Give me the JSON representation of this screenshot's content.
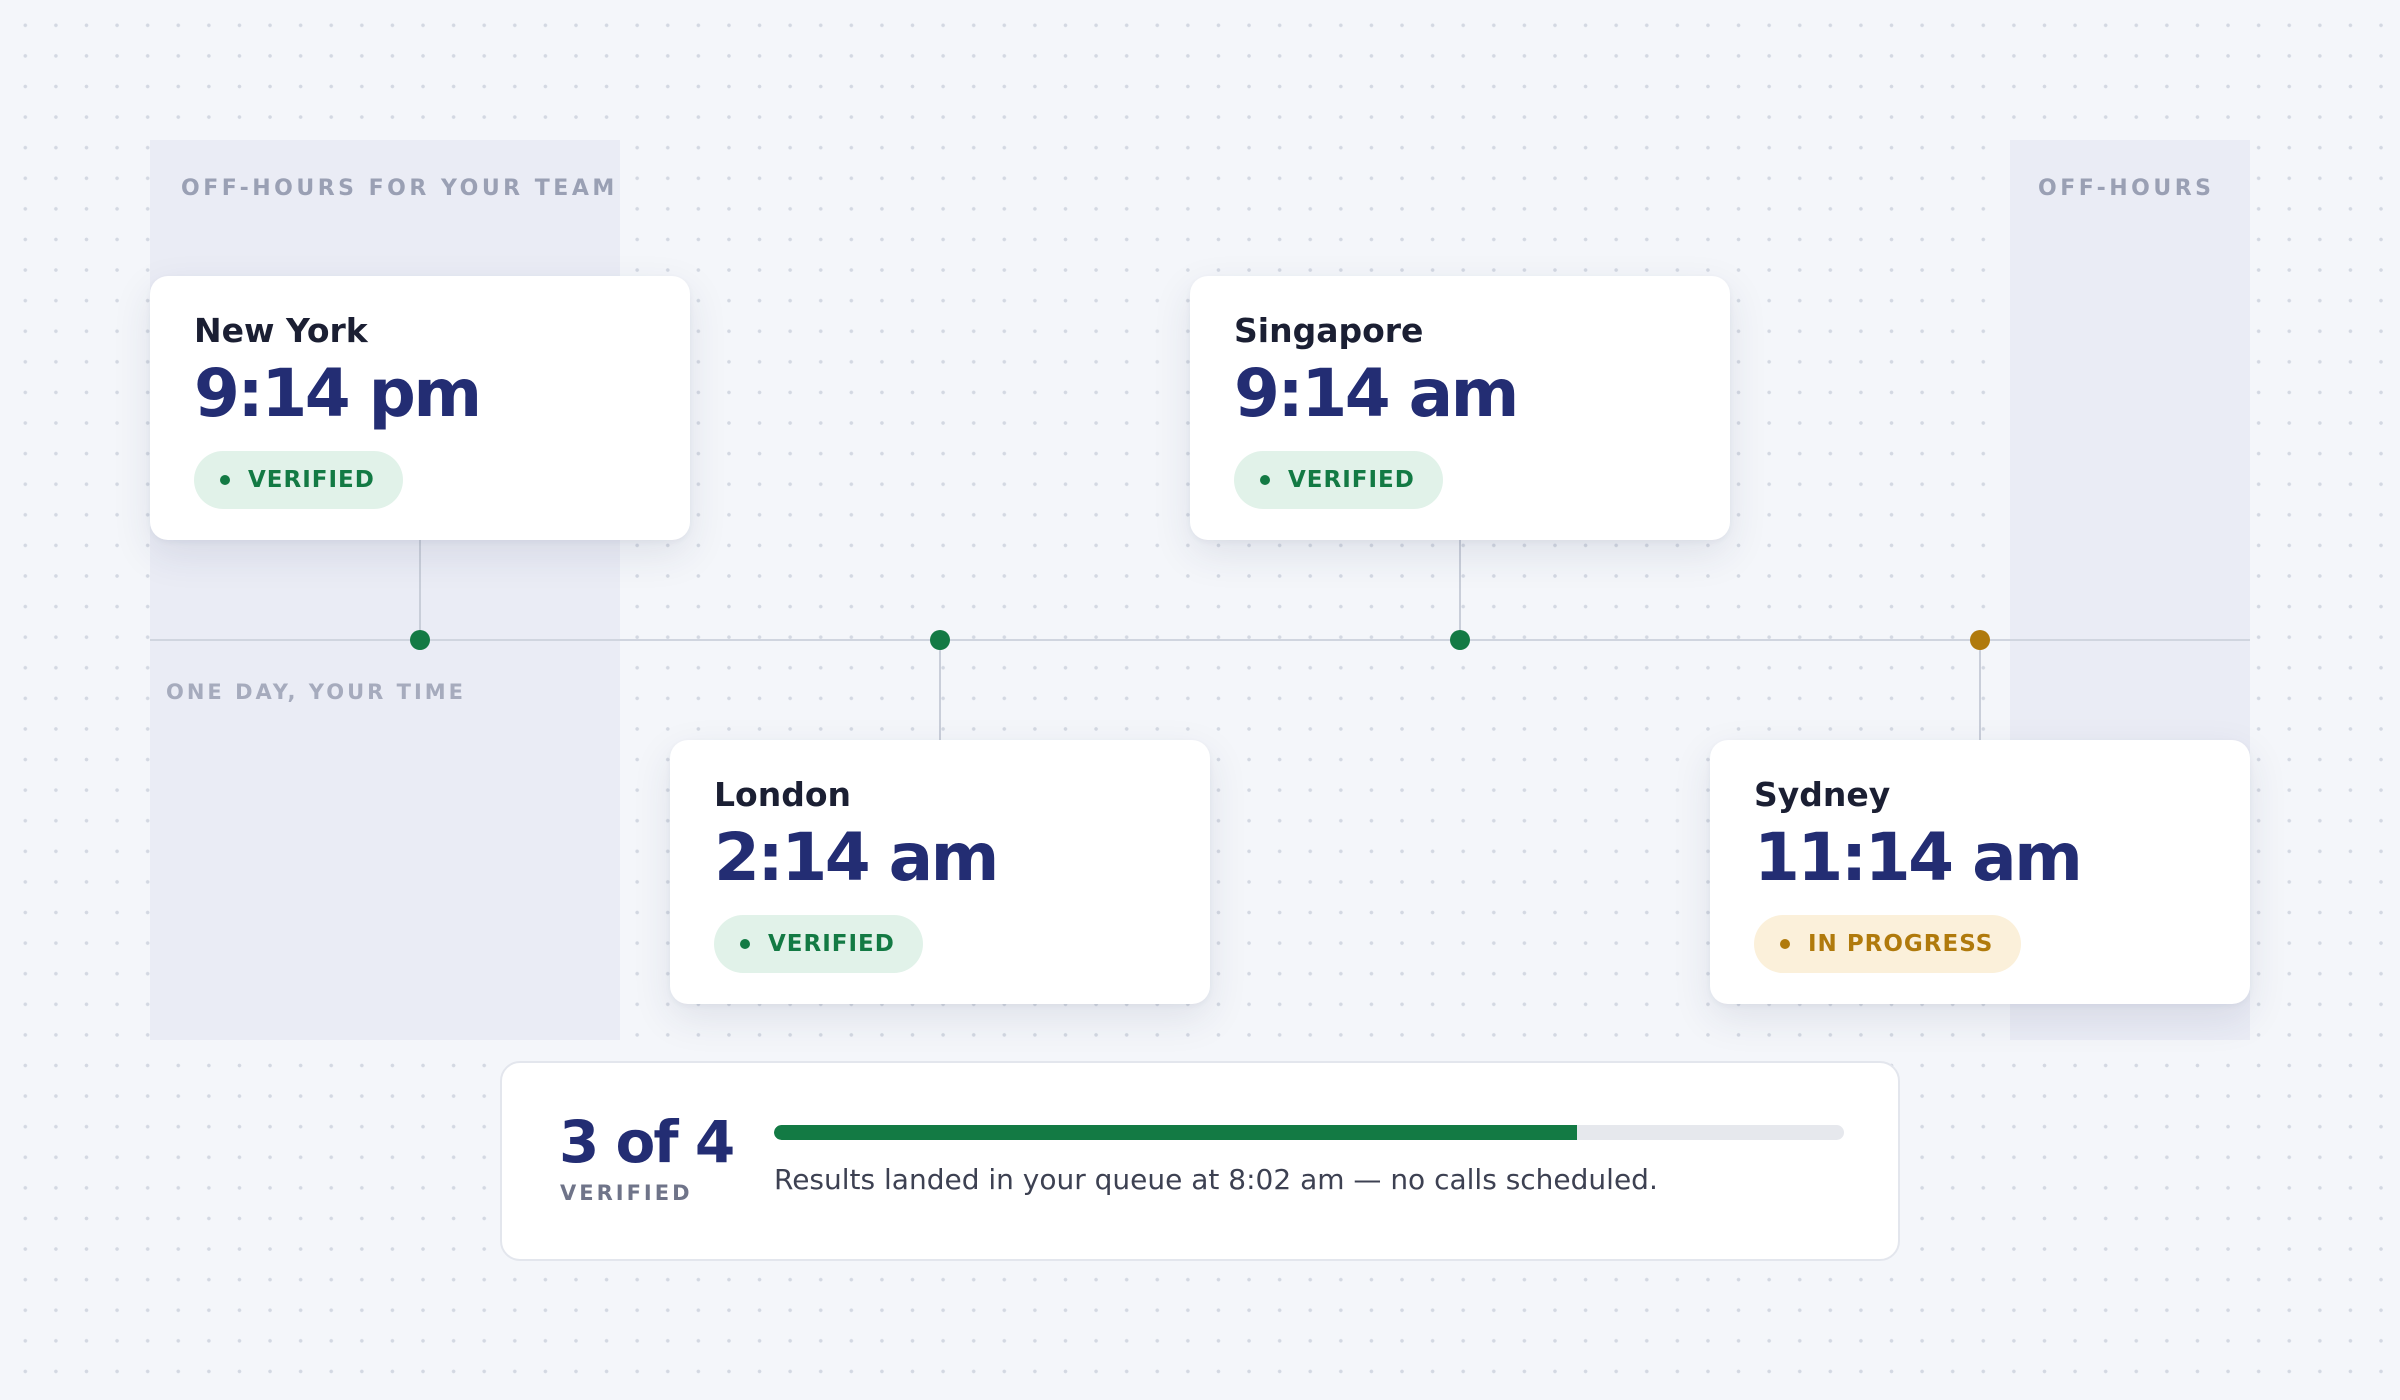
{
  "off_hours": {
    "left_label": "OFF-HOURS FOR YOUR TEAM",
    "right_label": "OFF-HOURS"
  },
  "timeline": {
    "axis_label": "ONE DAY, YOUR TIME"
  },
  "cities": [
    {
      "name": "New York",
      "time": "9:14 pm",
      "status": "VERIFIED",
      "state": "verified"
    },
    {
      "name": "London",
      "time": "2:14 am",
      "status": "VERIFIED",
      "state": "verified"
    },
    {
      "name": "Singapore",
      "time": "9:14 am",
      "status": "VERIFIED",
      "state": "verified"
    },
    {
      "name": "Sydney",
      "time": "11:14 am",
      "status": "IN PROGRESS",
      "state": "in-progress"
    }
  ],
  "summary": {
    "count": "3 of 4",
    "count_label": "VERIFIED",
    "progress": 0.75,
    "message": "Results landed in your queue at 8:02 am — no calls scheduled."
  },
  "colors": {
    "verified": "#137a44",
    "in_progress": "#b07a0c",
    "time_text": "#232d73"
  }
}
